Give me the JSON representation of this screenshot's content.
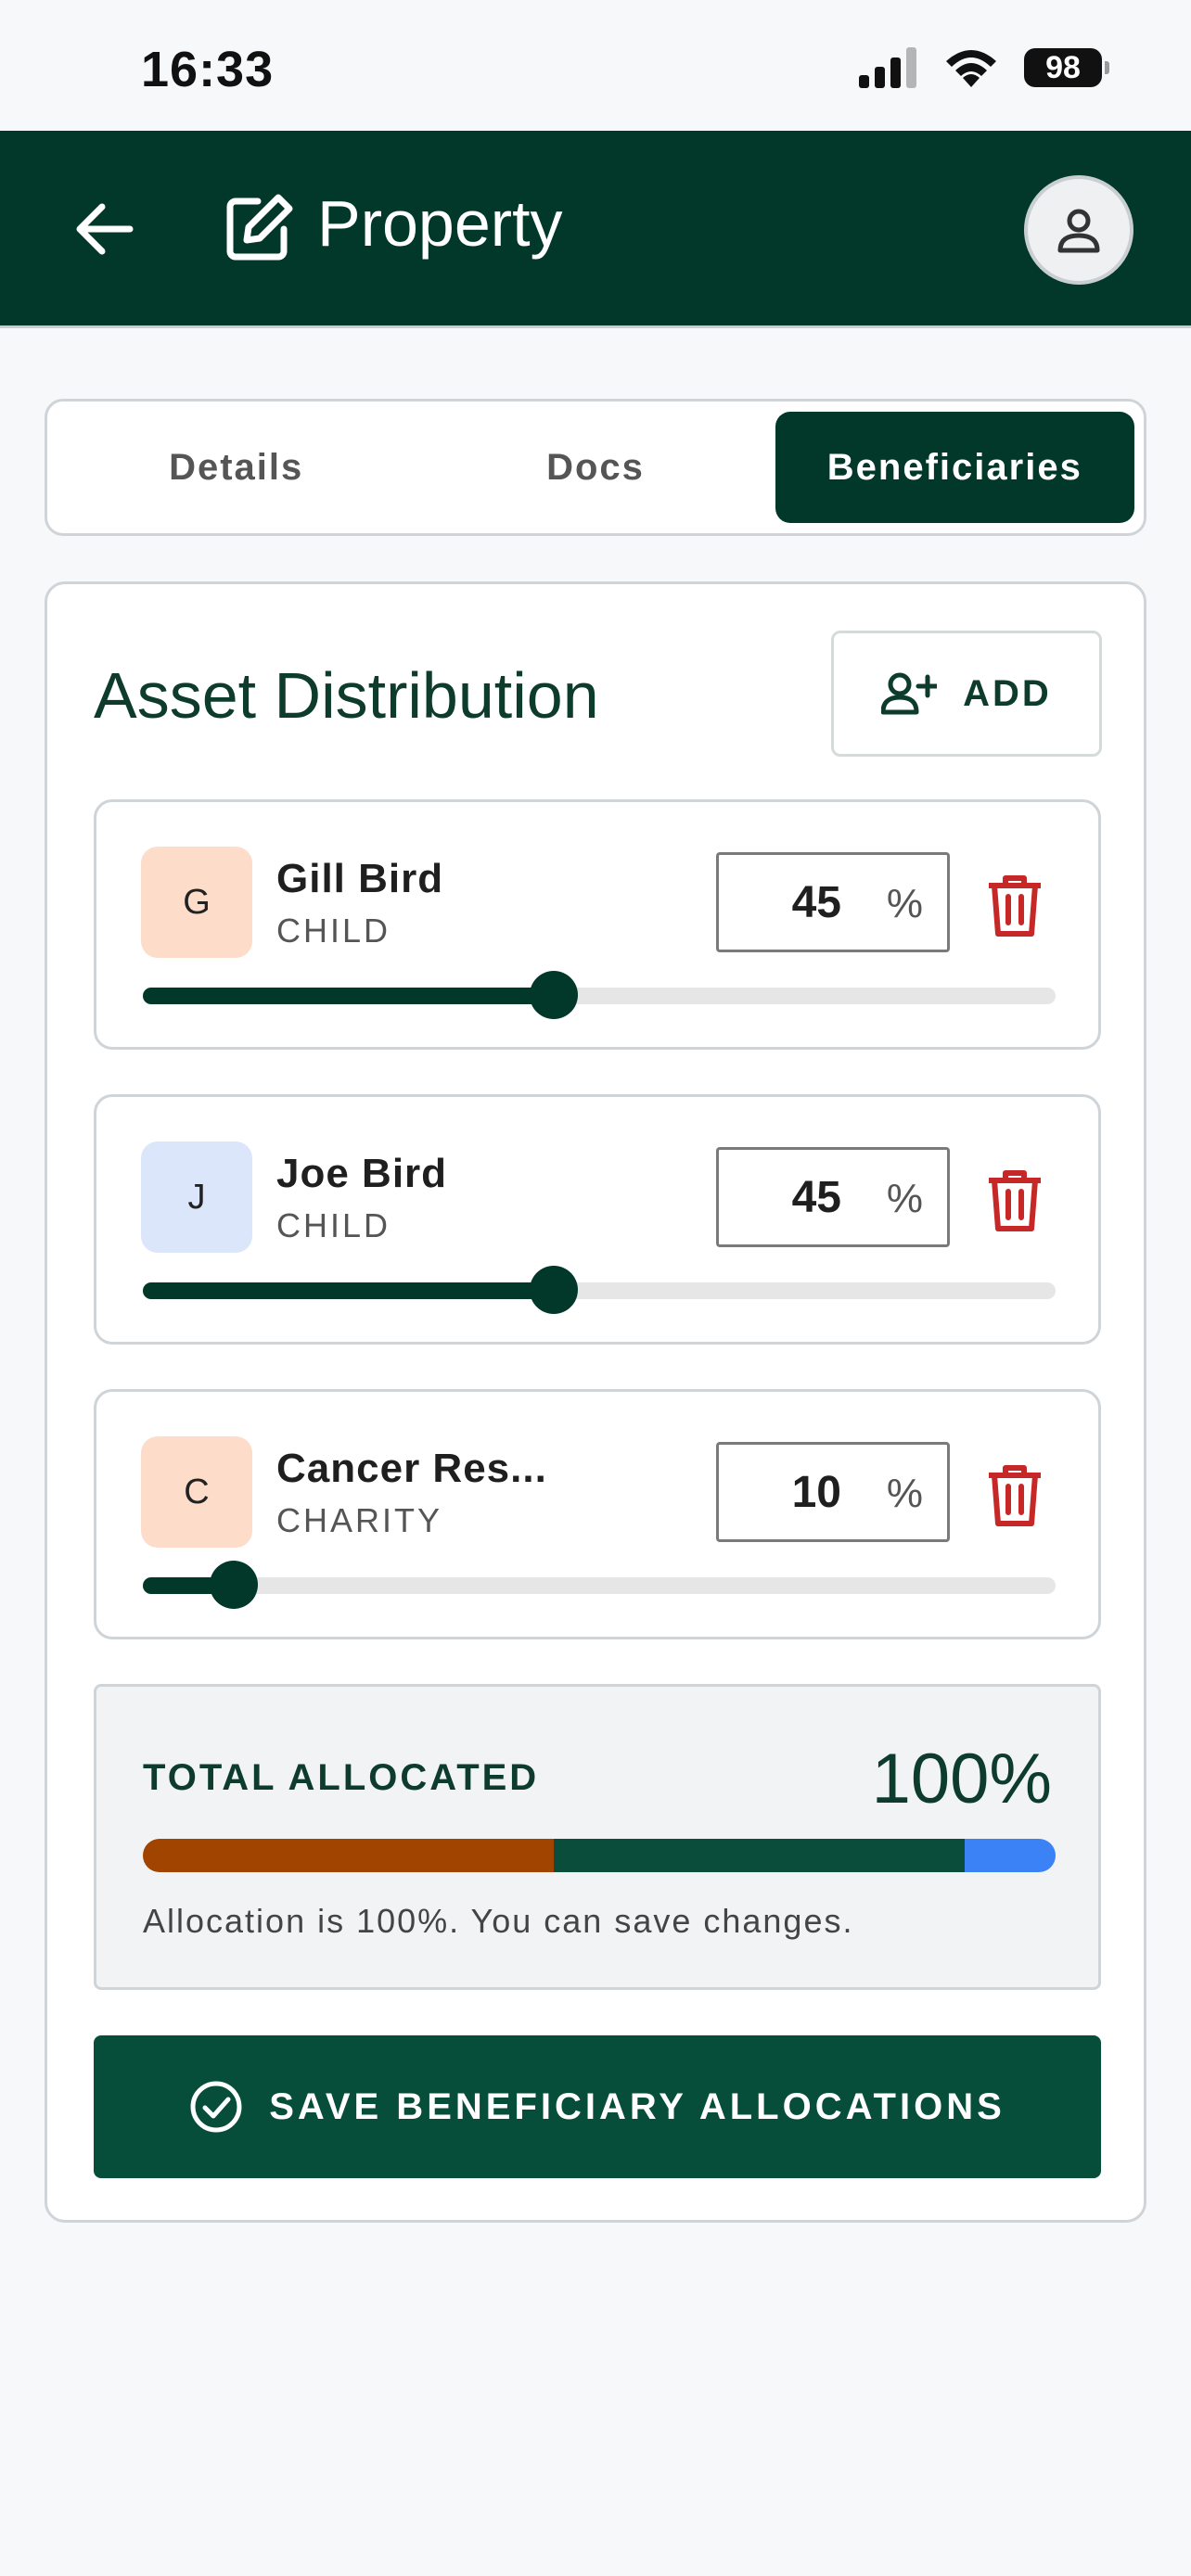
{
  "status_bar": {
    "time": "16:33",
    "battery": "98"
  },
  "header": {
    "title": "Property"
  },
  "tabs": [
    {
      "label": "Details",
      "active": false
    },
    {
      "label": "Docs",
      "active": false
    },
    {
      "label": "Beneficiaries",
      "active": true
    }
  ],
  "section": {
    "title": "Asset Distribution",
    "add_label": "ADD"
  },
  "beneficiaries": [
    {
      "initial": "G",
      "name": "Gill Bird",
      "role": "CHILD",
      "percent": "45",
      "percent_sign": "%",
      "avatar_color": "#fddcc9"
    },
    {
      "initial": "J",
      "name": "Joe Bird",
      "role": "CHILD",
      "percent": "45",
      "percent_sign": "%",
      "avatar_color": "#dbe6fb"
    },
    {
      "initial": "C",
      "name": "Cancer Res...",
      "role": "CHARITY",
      "percent": "10",
      "percent_sign": "%",
      "avatar_color": "#fddcc9"
    }
  ],
  "total": {
    "label": "TOTAL ALLOCATED",
    "value": "100%",
    "message": "Allocation is 100%. You can save changes.",
    "segments": [
      {
        "percent": 45,
        "color": "#a04400"
      },
      {
        "percent": 45,
        "color": "#0a4d3a"
      },
      {
        "percent": 10,
        "color": "#3b82f6"
      }
    ]
  },
  "save_button": {
    "label": "SAVE BENEFICIARY ALLOCATIONS"
  },
  "colors": {
    "primary": "#01382a",
    "delete": "#c62828",
    "accent_blue": "#3b82f6",
    "accent_orange": "#a04400"
  }
}
